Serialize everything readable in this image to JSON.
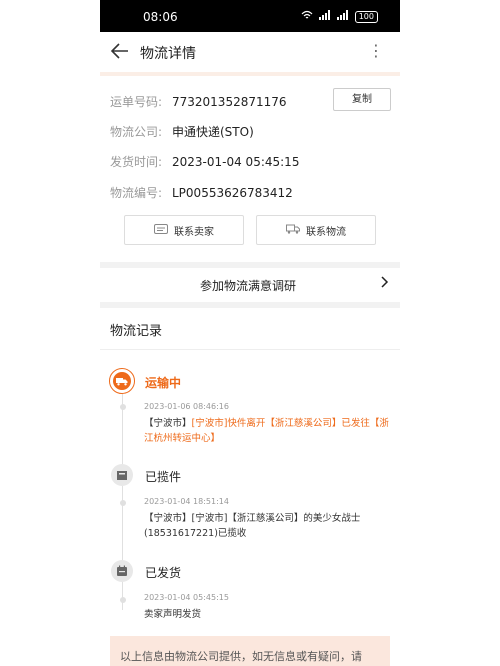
{
  "status_bar": {
    "time": "08:06",
    "battery": "100"
  },
  "header": {
    "title": "物流详情",
    "more": "⋮"
  },
  "info": {
    "rows": [
      {
        "label": "运单号码:",
        "value": "773201352871176"
      },
      {
        "label": "物流公司:",
        "value": "申通快递(STO)"
      },
      {
        "label": "发货时间:",
        "value": "2023-01-04 05:45:15"
      },
      {
        "label": "物流编号:",
        "value": "LP00553626783412"
      }
    ],
    "copy_label": "复制"
  },
  "actions": {
    "contact_seller": "联系卖家",
    "contact_logistics": "联系物流"
  },
  "survey": {
    "label": "参加物流满意调研"
  },
  "records": {
    "title": "物流记录",
    "items": [
      {
        "status": "运输中",
        "timestamp": "2023-01-06  08:46:16",
        "desc_prefix": "【宁波市】",
        "desc_highlight": "[宁波市]快件离开【浙江慈溪公司】已发往【浙江杭州转运中心】"
      },
      {
        "status": "已揽件",
        "timestamp": "2023-01-04  18:51:14",
        "desc": "【宁波市】[宁波市]【浙江慈溪公司】的美少女战士(18531617221)已揽收"
      },
      {
        "status": "已发货",
        "timestamp": "2023-01-04  05:45:15",
        "desc": "卖家声明发货"
      }
    ]
  },
  "notice": {
    "text": "以上信息由物流公司提供，如无信息或有疑问，请"
  },
  "colors": {
    "accent": "#ee6a1a",
    "notice_bg": "#fbe7dd"
  }
}
